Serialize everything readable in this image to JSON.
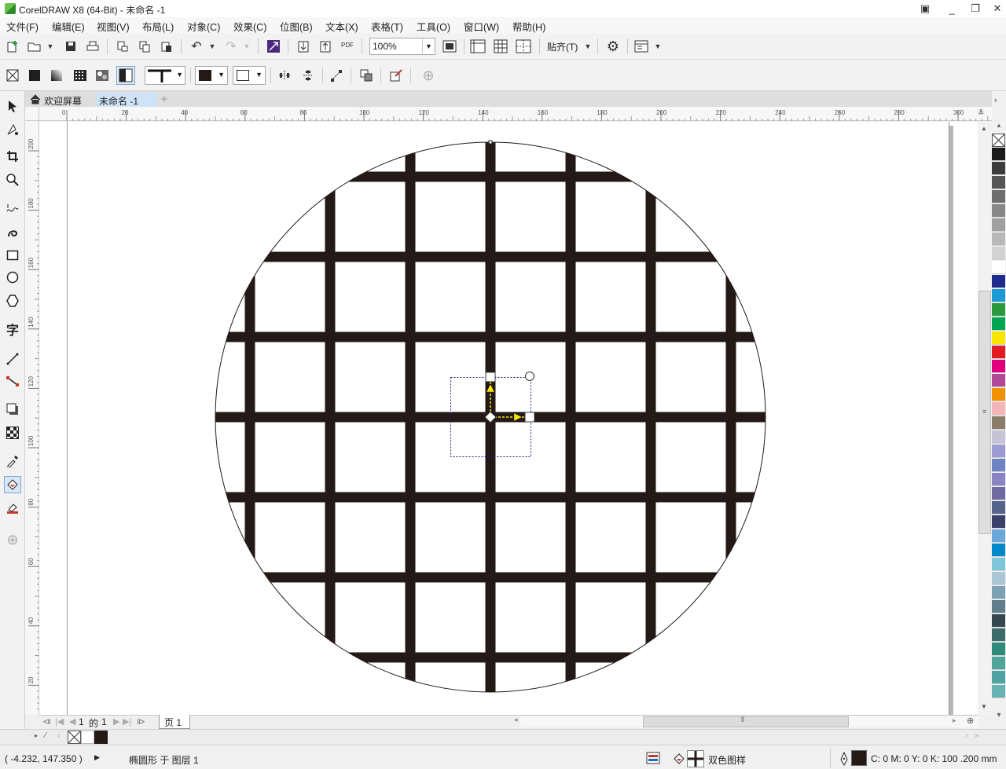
{
  "window": {
    "title": "CorelDRAW X8 (64-Bit) - 未命名 -1",
    "controls": [
      "_",
      "❐",
      "✕"
    ]
  },
  "menu": [
    "文件(F)",
    "编辑(E)",
    "视图(V)",
    "布局(L)",
    "对象(C)",
    "效果(C)",
    "位图(B)",
    "文本(X)",
    "表格(T)",
    "工具(O)",
    "窗口(W)",
    "帮助(H)"
  ],
  "toolbar": {
    "zoom_value": "100%",
    "snap_label": "贴齐(T)",
    "export_pdf_label": "PDF"
  },
  "document_tabs": [
    {
      "label": "欢迎屏幕",
      "active": false
    },
    {
      "label": "未命名 -1",
      "active": true
    }
  ],
  "ruler": {
    "units": "mm",
    "horizontal_ticks": [
      "0",
      "20",
      "40",
      "60",
      "80",
      "100",
      "120",
      "140",
      "160",
      "180",
      "200",
      "220",
      "240",
      "260",
      "280",
      "300"
    ],
    "vertical_ticks": [
      "200",
      "180",
      "160",
      "140",
      "120",
      "100",
      "80",
      "60",
      "40",
      "20"
    ]
  },
  "page_navigator": {
    "current": "1",
    "of_label": "的",
    "total": "1",
    "page_tab": "页 1"
  },
  "status": {
    "cursor_position": "( -4.232, 147.350 )",
    "object_info": "椭圆形 于 图层 1",
    "fill_type": "双色图样",
    "outline": "C: 0 M: 0 Y: 0 K: 100  .200 mm"
  },
  "colors": {
    "fill_pattern": "#231916",
    "accent_tab": "#cfe3f6",
    "selection_box": "#1a1a8c",
    "handle_arrow": "#ffe600"
  },
  "palette": [
    "#ffffff",
    "#1a1a1a",
    "#3c3c3c",
    "#555555",
    "#6e6e6e",
    "#878787",
    "#a0a0a0",
    "#b9b9b9",
    "#d2d2d2",
    "#ffffff",
    "#1e2b8f",
    "#1b9ad6",
    "#2b9a3f",
    "#00a651",
    "#f7e700",
    "#e31b23",
    "#e2007a",
    "#b24997",
    "#f39200",
    "#f4b6b6",
    "#8c7d6a",
    "#c6c3d8",
    "#9c9ad0",
    "#6f84c3",
    "#8b84c4",
    "#6f6a9f",
    "#56648c",
    "#3c3f6a",
    "#6aa7dc",
    "#0088c8",
    "#7fc6d8",
    "#a9c7d4",
    "#7ca1b0",
    "#607d8b",
    "#37474f",
    "#3d6b6b",
    "#2e8b7a",
    "#4fa59a",
    "#51a3a3",
    "#67b3b3"
  ]
}
